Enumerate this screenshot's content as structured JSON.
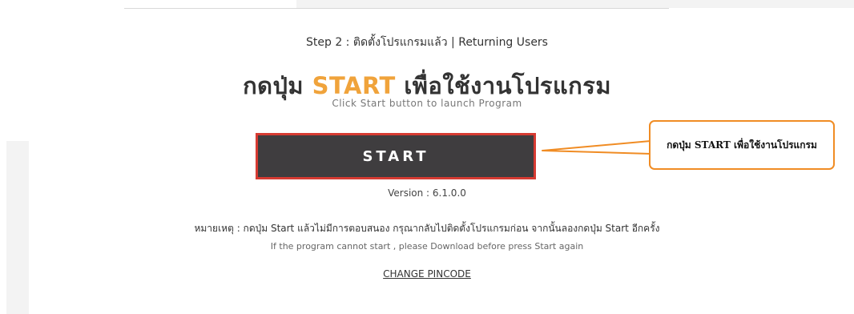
{
  "step_text": "Step 2 : ติดตั้งโปรแกรมแล้ว | Returning Users",
  "heading": {
    "prefix": "กดปุ่ม",
    "accent": "START",
    "suffix": "เพื่อใช้งานโปรแกรม",
    "accent_color": "#f0a33b"
  },
  "subheading": "Click Start button to launch Program",
  "start_button": {
    "label": "START",
    "bg_color": "#3f3d3f",
    "border_color": "#d63b32"
  },
  "version_text": "Version : 6.1.0.0",
  "note_th": "หมายเหตุ : กดปุ่ม Start แล้วไม่มีการตอบสนอง กรุณากลับไปติดตั้งโปรแกรมก่อน จากนั้นลองกดปุ่ม Start อีกครั้ง",
  "note_en": "If the program cannot start , please Download before press Start again",
  "change_pincode_label": "CHANGE PINCODE",
  "callout": {
    "text": "กดปุ่ม START เพื่อใช้งานโปรแกรม",
    "border_color": "#f08c24"
  }
}
